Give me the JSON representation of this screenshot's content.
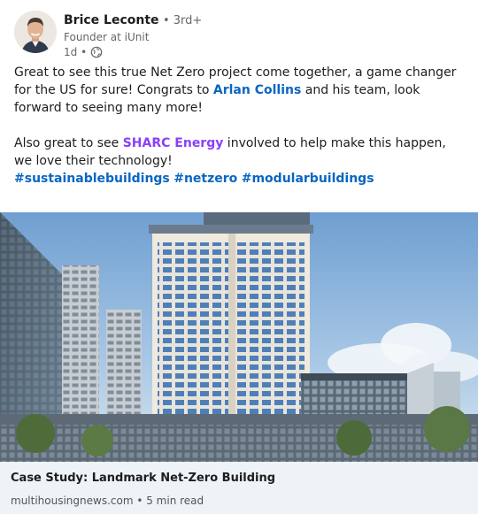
{
  "author": {
    "name": "Brice Leconte",
    "degree": "• 3rd+",
    "headline": "Founder at iUnit",
    "time": "1d •",
    "visibility_icon": "globe-icon"
  },
  "post": {
    "para1_a": "Great to see this true Net Zero project come together, a game changer for the US for sure! Congrats to ",
    "mention_person": "Arlan Collins",
    "para1_b": " and his team, look forward to seeing many more!",
    "para2_a": "Also great to see ",
    "mention_company": "SHARC Energy",
    "para2_b": " involved to help make this happen, we love their technology!",
    "hashtags": [
      "#sustainablebuildings",
      "#netzero",
      "#modularbuildings"
    ]
  },
  "article": {
    "title": "Case Study: Landmark Net-Zero Building",
    "source": "multihousingnews.com • 5 min read"
  },
  "colors": {
    "link_blue": "#0a66c2",
    "company_purple": "#8a3ffc",
    "article_bg": "#eef3f8"
  }
}
